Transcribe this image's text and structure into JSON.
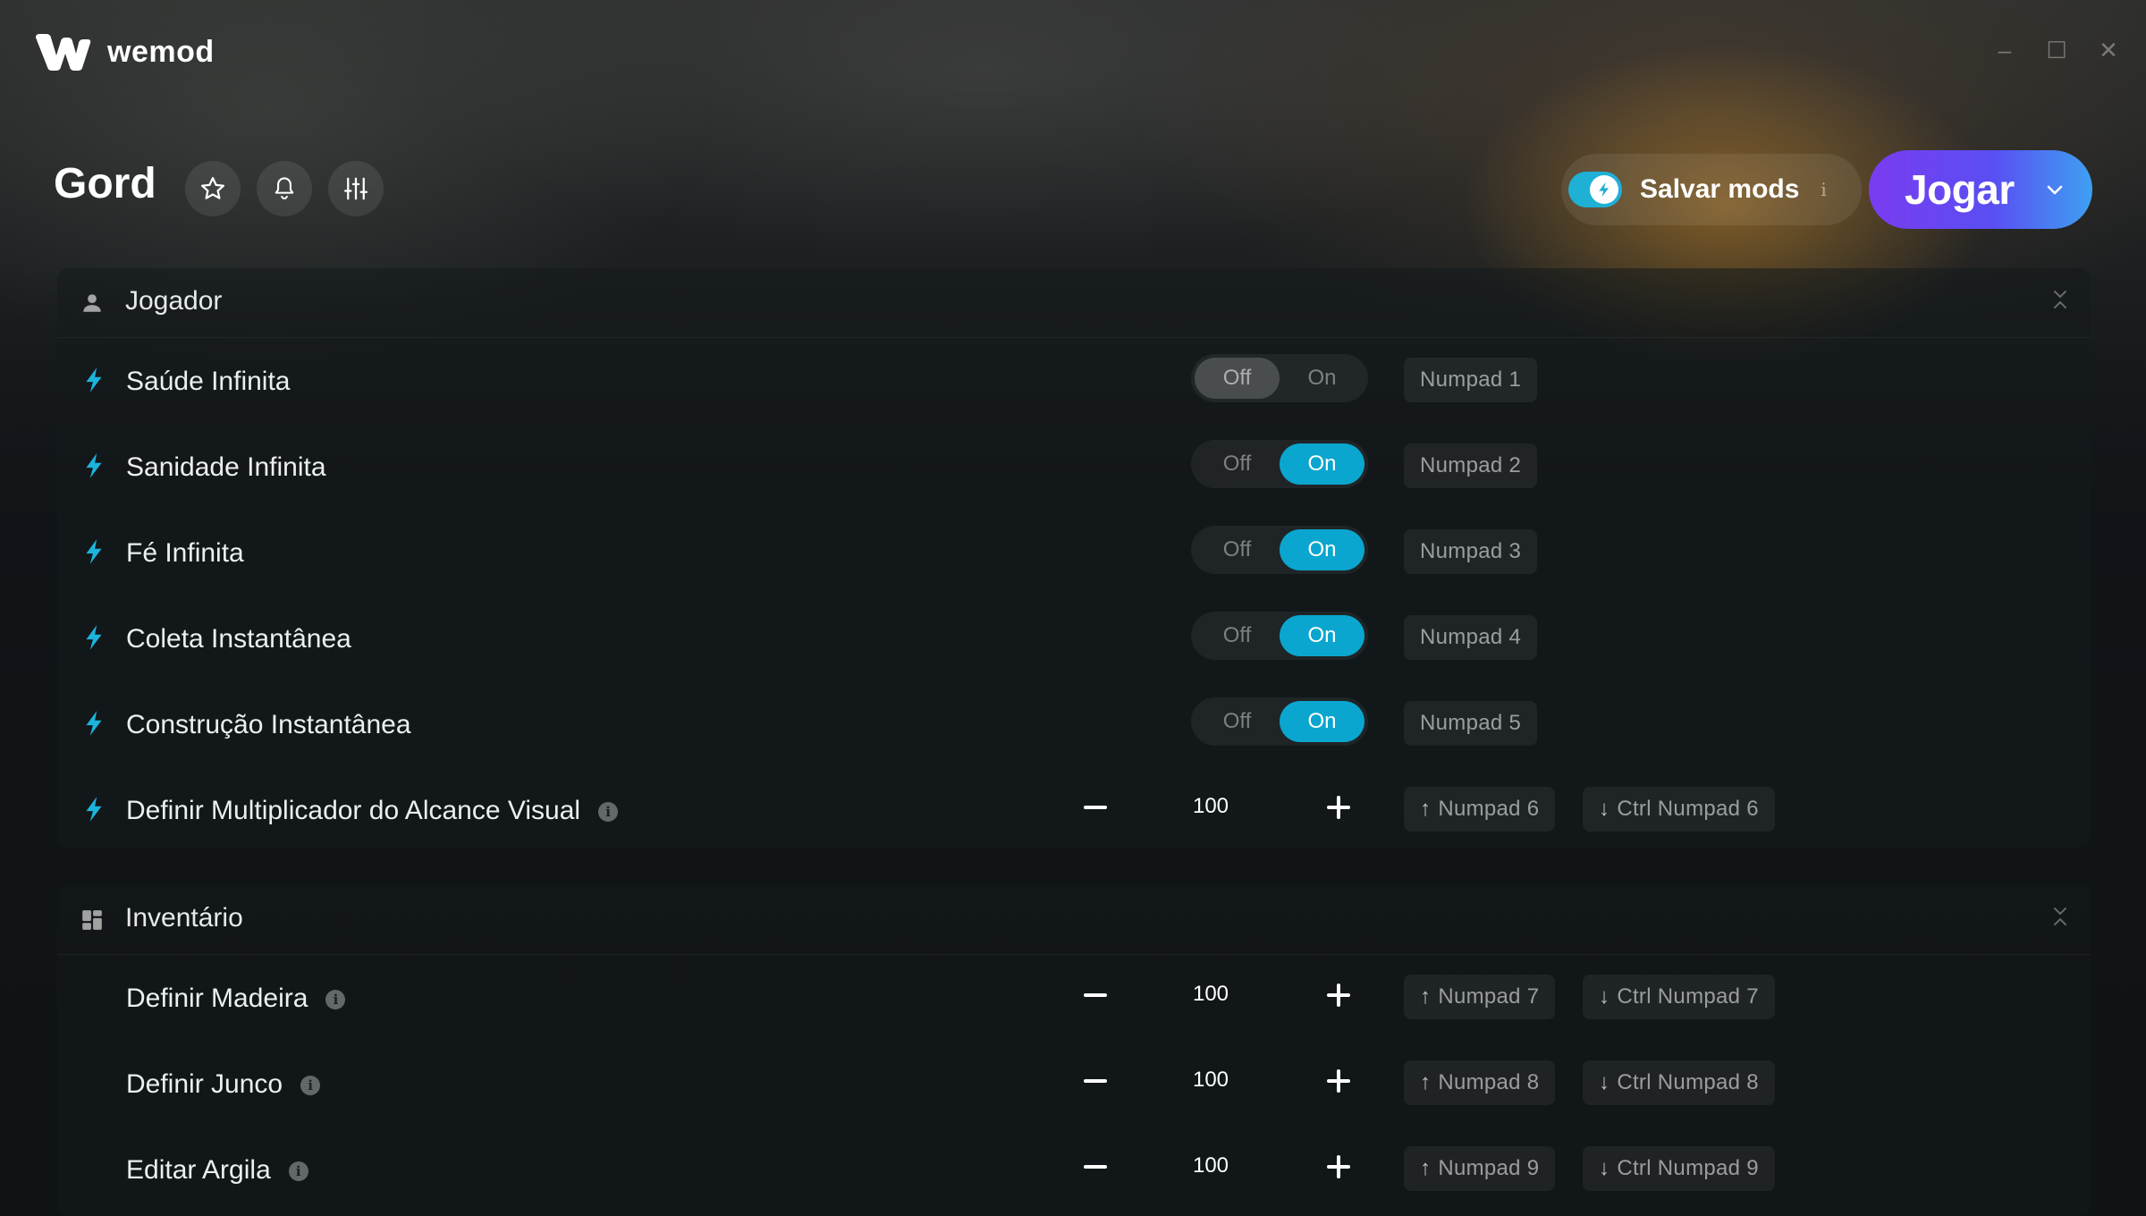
{
  "app": {
    "name": "wemod"
  },
  "window": {
    "minimize": "–",
    "maximize": "☐",
    "close": "✕"
  },
  "header": {
    "game_title": "Gord",
    "save_mods": {
      "label": "Salvar mods",
      "info": "i",
      "enabled": true
    },
    "play": {
      "label": "Jogar"
    }
  },
  "colors": {
    "accent": "#0aa6cf",
    "play_start": "#7a3cf0",
    "play_end": "#3ea0f2"
  },
  "sections": [
    {
      "title": "Jogador",
      "icon": "user-icon",
      "rows": [
        {
          "label": "Saúde Infinita",
          "type": "toggle",
          "off": "Off",
          "on": "On",
          "state": "Off",
          "key1": "Numpad 1"
        },
        {
          "label": "Sanidade Infinita",
          "type": "toggle",
          "off": "Off",
          "on": "On",
          "state": "On",
          "key1": "Numpad 2"
        },
        {
          "label": "Fé Infinita",
          "type": "toggle",
          "off": "Off",
          "on": "On",
          "state": "On",
          "key1": "Numpad 3"
        },
        {
          "label": "Coleta Instantânea",
          "type": "toggle",
          "off": "Off",
          "on": "On",
          "state": "On",
          "key1": "Numpad 4"
        },
        {
          "label": "Construção Instantânea",
          "type": "toggle",
          "off": "Off",
          "on": "On",
          "state": "On",
          "key1": "Numpad 5"
        },
        {
          "label": "Definir Multiplicador do Alcance Visual",
          "type": "stepper",
          "value": "100",
          "key1": "Numpad 6",
          "key2": "Ctrl Numpad 6"
        }
      ]
    },
    {
      "title": "Inventário",
      "icon": "dashboard-icon",
      "rows": [
        {
          "label": "Definir Madeira",
          "type": "stepper",
          "value": "100",
          "key1": "Numpad 7",
          "key2": "Ctrl Numpad 7"
        },
        {
          "label": "Definir Junco",
          "type": "stepper",
          "value": "100",
          "key1": "Numpad 8",
          "key2": "Ctrl Numpad 8"
        },
        {
          "label": "Editar Argila",
          "type": "stepper",
          "value": "100",
          "key1": "Numpad 9",
          "key2": "Ctrl Numpad 9"
        }
      ]
    }
  ]
}
